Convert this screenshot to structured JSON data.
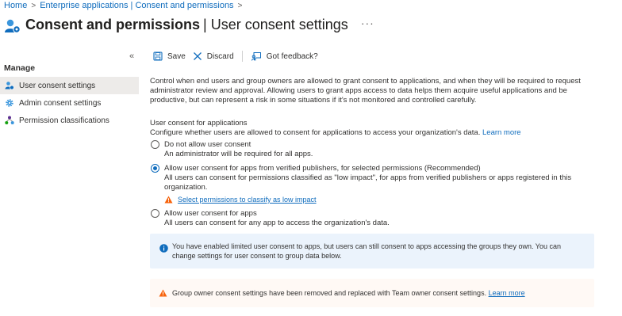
{
  "breadcrumb": {
    "home": "Home",
    "current": "Enterprise applications | Consent and permissions",
    "separator": ">"
  },
  "header": {
    "title_main": "Consent and permissions",
    "title_sub": "| User consent settings",
    "more": "···"
  },
  "sidebar": {
    "collapse": "«",
    "section": "Manage",
    "items": [
      {
        "label": "User consent settings",
        "icon": "user-consent-icon",
        "active": true
      },
      {
        "label": "Admin consent settings",
        "icon": "gear-icon",
        "active": false
      },
      {
        "label": "Permission classifications",
        "icon": "classification-icon",
        "active": false
      }
    ]
  },
  "toolbar": {
    "save": "Save",
    "discard": "Discard",
    "feedback": "Got feedback?"
  },
  "main": {
    "description": "Control when end users and group owners are allowed to grant consent to applications, and when they will be required to request administrator review and approval. Allowing users to grant apps access to data helps them acquire useful applications and be productive, but can represent a risk in some situations if it's not monitored and controlled carefully.",
    "section_label": "User consent for applications",
    "section_sub": "Configure whether users are allowed to consent for applications to access your organization's data.",
    "learn_more": "Learn more",
    "options": [
      {
        "title": "Do not allow user consent",
        "desc": "An administrator will be required for all apps.",
        "checked": false
      },
      {
        "title": "Allow user consent for apps from verified publishers, for selected permissions (Recommended)",
        "desc": "All users can consent for permissions classified as \"low impact\", for apps from verified publishers or apps registered in this organization.",
        "checked": true,
        "link": "Select permissions to classify as low impact"
      },
      {
        "title": "Allow user consent for apps",
        "desc": "All users can consent for any app to access the organization's data.",
        "checked": false
      }
    ]
  },
  "info_box": {
    "text": "You have enabled limited user consent to apps, but users can still consent to apps accessing the groups they own. You can change settings for user consent to group data below."
  },
  "warning_box": {
    "text": "Group owner consent settings have been removed and replaced with Team owner consent settings.",
    "link": "Learn more"
  },
  "colors": {
    "accent": "#0f6cbd",
    "warning": "#f7630c",
    "info_bg": "#ebf3fc",
    "warning_bg": "#fff9f5"
  }
}
